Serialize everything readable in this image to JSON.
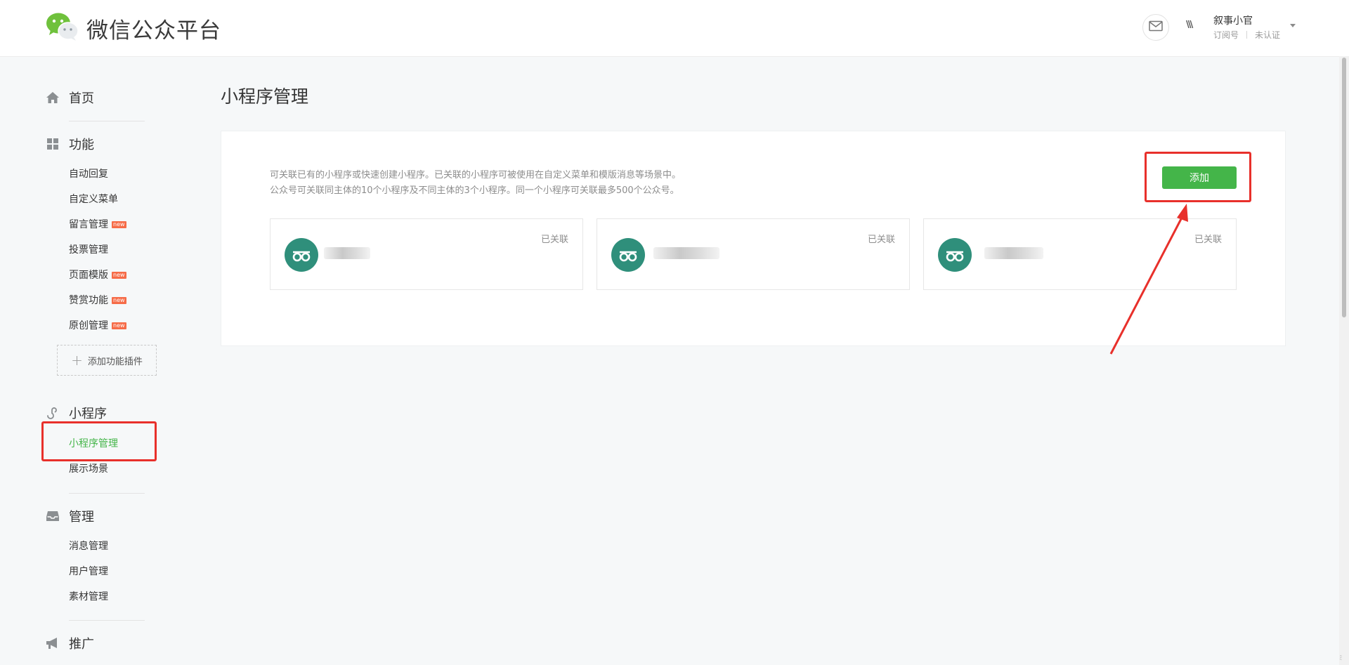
{
  "header": {
    "brand": "微信公众平台",
    "account": {
      "avatar_text": "\\\\\\",
      "name": "叙事小官",
      "type": "订阅号",
      "verify": "未认证"
    },
    "icons": [
      "wechat-logo-icon",
      "mail-icon",
      "chevron-down-icon"
    ]
  },
  "sidebar": {
    "home": {
      "label": "首页",
      "icon": "home-icon"
    },
    "features": {
      "label": "功能",
      "icon": "grid-icon",
      "items": [
        {
          "label": "自动回复",
          "badge": ""
        },
        {
          "label": "自定义菜单",
          "badge": ""
        },
        {
          "label": "留言管理",
          "badge": "new"
        },
        {
          "label": "投票管理",
          "badge": ""
        },
        {
          "label": "页面模版",
          "badge": "new"
        },
        {
          "label": "赞赏功能",
          "badge": "new"
        },
        {
          "label": "原创管理",
          "badge": "new"
        }
      ],
      "add_plugin": "添加功能插件"
    },
    "miniprogram": {
      "label": "小程序",
      "icon": "miniprogram-icon",
      "items": [
        {
          "label": "小程序管理",
          "active": true
        },
        {
          "label": "展示场景",
          "active": false
        }
      ]
    },
    "manage": {
      "label": "管理",
      "icon": "inbox-icon",
      "items": [
        {
          "label": "消息管理"
        },
        {
          "label": "用户管理"
        },
        {
          "label": "素材管理"
        }
      ]
    },
    "promote": {
      "label": "推广",
      "icon": "megaphone-icon"
    }
  },
  "main": {
    "title": "小程序管理",
    "description": [
      "可关联已有的小程序或快速创建小程序。已关联的小程序可被使用在自定义菜单和模版消息等场景中。",
      "公众号可关联同主体的10个小程序及不同主体的3个小程序。同一个小程序可关联最多500个公众号。"
    ],
    "add_button": "添加",
    "cards": [
      {
        "status": "已关联",
        "icon": "miniprogram-logo-icon"
      },
      {
        "status": "已关联",
        "icon": "miniprogram-logo-icon"
      },
      {
        "status": "已关联",
        "icon": "miniprogram-logo-icon"
      }
    ]
  },
  "colors": {
    "accent_green": "#44b549",
    "annotation_red": "#e8302b",
    "badge_orange": "#f66c48",
    "card_avatar": "#2f8f7b"
  },
  "corner_mark": "ﾐ"
}
